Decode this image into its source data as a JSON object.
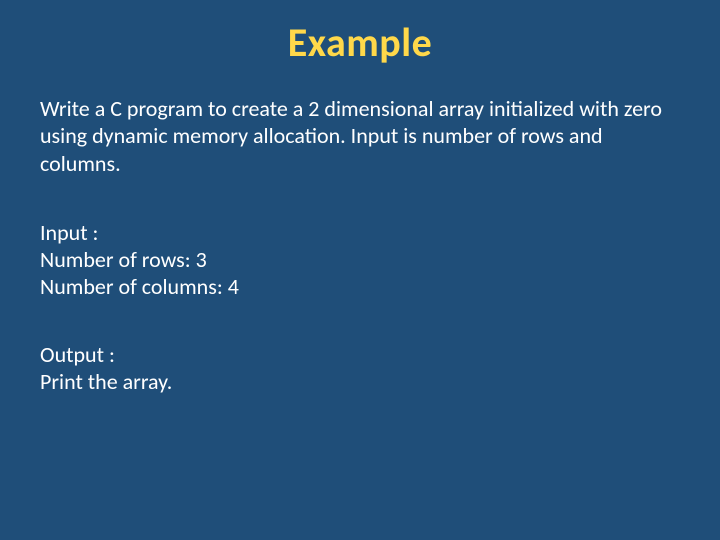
{
  "title": "Example",
  "description": "Write a C program to create a 2 dimensional array initialized with zero using dynamic memory allocation. Input is number of rows and columns.",
  "input": {
    "header": "Input :",
    "rows_line": "Number of rows: 3",
    "cols_line": "Number of columns: 4"
  },
  "output": {
    "header": "Output :",
    "line": "Print the array."
  }
}
